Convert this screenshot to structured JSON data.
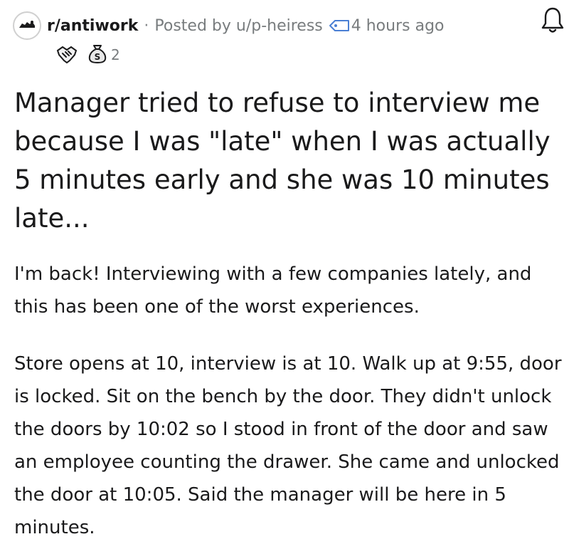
{
  "header": {
    "subreddit": "r/antiwork",
    "separator": "·",
    "posted_by": "Posted by u/p-heiress",
    "time": "4 hours ago",
    "avatar_icon": "antiwork-dog-icon",
    "tag_icon": "tag-icon",
    "notification_icon": "bell-icon"
  },
  "awards": [
    {
      "icon": "handshake-award-icon",
      "count": ""
    },
    {
      "icon": "money-bag-award-icon",
      "count": "2"
    }
  ],
  "post": {
    "title": "Manager tried to refuse to interview me because I was \"late\" when I was actually 5 minutes early and she was 10 minutes late...",
    "paragraphs": [
      "I'm back! Interviewing with a few companies lately, and this has been one of the worst experiences.",
      "Store opens at 10, interview is at 10. Walk up at 9:55, door is locked. Sit on the bench by the door. They didn't unlock the doors by 10:02 so I stood in front of the door and saw an employee counting the drawer. She came and unlocked the door at 10:05. Said the manager will be here in 5 minutes."
    ]
  },
  "colors": {
    "text": "#1a1a1b",
    "meta": "#787c7e",
    "tag_blue": "#4a7fd4"
  }
}
